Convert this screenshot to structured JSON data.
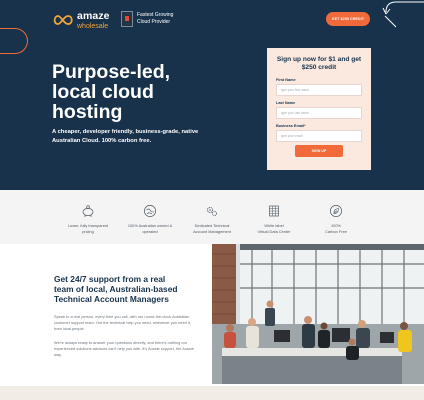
{
  "brand": {
    "name": "amaze",
    "sub": "wholesale",
    "accent": "#f26a39",
    "navy": "#17324a"
  },
  "badge": {
    "line1": "Fastest Growing",
    "line2": "Cloud Provider"
  },
  "header": {
    "cta_label": "GET $250 CREDIT"
  },
  "hero": {
    "headline_lines": [
      "Purpose-led,",
      "local cloud",
      "hosting"
    ],
    "subline": "A cheaper, developer friendly, business-grade, native Australian Cloud. 100% carbon free."
  },
  "form": {
    "title_line1": "Sign up now for $1 and get",
    "title_line2": "$250 credit",
    "fields": [
      {
        "label": "First Name",
        "placeholder": "type your first name"
      },
      {
        "label": "Last Name",
        "placeholder": "type your last name"
      },
      {
        "label": "Business Email*",
        "placeholder": "type your email"
      }
    ],
    "submit_label": "SIGN UP"
  },
  "features": [
    {
      "icon": "piggy-bank-icon",
      "line1": "Lower, fully transparent",
      "line2": "pricing"
    },
    {
      "icon": "globe-icon",
      "line1": "100% Australian owned &",
      "line2": "operated"
    },
    {
      "icon": "gears-icon",
      "line1": "Dedicated Technical",
      "line2": "Account Management"
    },
    {
      "icon": "data-center-icon",
      "line1": "White label",
      "line2": "Virtual Data Center"
    },
    {
      "icon": "leaf-icon",
      "line1": "100%",
      "line2": "Carbon Free"
    }
  ],
  "support": {
    "title_lines": [
      "Get 24/7 support from a real",
      "team of local, Australian-based",
      "Technical Account Managers"
    ],
    "para1": "Speak to a real person, every time you call, with our round-the-clock Australian customer support team. Get the technical help you need, whenever you need it, from local people.",
    "para2": "We're always ready to answer your questions directly, and there's nothing our experienced solutions advisors can't help you with. It's Aussie support, the Aussie way."
  }
}
